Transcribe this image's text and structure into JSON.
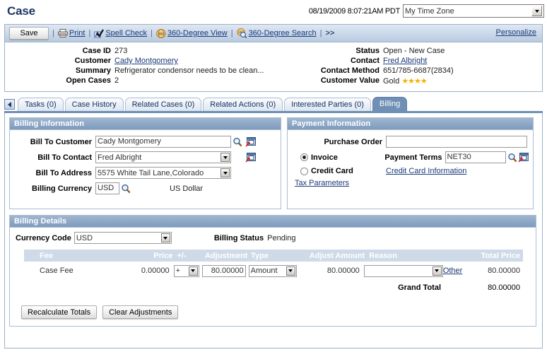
{
  "header": {
    "title": "Case",
    "datetime": "08/19/2009 8:07:21AM PDT",
    "timezone_value": "My Time Zone"
  },
  "toolbar": {
    "save_label": "Save",
    "print_label": "Print",
    "spell_check_label": "Spell Check",
    "view_360_label": "360-Degree View",
    "search_360_label": "360-Degree Search",
    "more_label": ">>",
    "personalize_label": "Personalize",
    "separator": "|"
  },
  "summary": {
    "left": [
      {
        "label": "Case ID",
        "value": "273",
        "link": false
      },
      {
        "label": "Customer",
        "value": "Cady Montgomery",
        "link": true
      },
      {
        "label": "Summary",
        "value": "Refrigerator condensor needs to be clean...",
        "link": false
      },
      {
        "label": "Open Cases",
        "value": "2",
        "link": false
      }
    ],
    "right": [
      {
        "label": "Status",
        "value": "Open - New Case",
        "link": false
      },
      {
        "label": "Contact",
        "value": "Fred Albright",
        "link": true
      },
      {
        "label": "Contact Method",
        "value": "651/785-6687(2834)",
        "link": false
      },
      {
        "label": "Customer Value",
        "value": "Gold",
        "link": false,
        "stars": "★★★★"
      }
    ]
  },
  "tabs": [
    {
      "label": "Tasks (0)",
      "active": false
    },
    {
      "label": "Case History",
      "active": false
    },
    {
      "label": "Related Cases (0)",
      "active": false
    },
    {
      "label": "Related Actions (0)",
      "active": false
    },
    {
      "label": "Interested Parties (0)",
      "active": false
    },
    {
      "label": "Billing",
      "active": true
    }
  ],
  "billing_information": {
    "title": "Billing Information",
    "bill_to_customer_label": "Bill To Customer",
    "bill_to_customer_value": "Cady Montgomery",
    "bill_to_contact_label": "Bill To Contact",
    "bill_to_contact_value": "Fred Albright",
    "bill_to_address_label": "Bill To Address",
    "bill_to_address_value": "5575 White Tail Lane,Colorado",
    "billing_currency_label": "Billing Currency",
    "billing_currency_value": "USD",
    "billing_currency_desc": "US Dollar"
  },
  "payment_information": {
    "title": "Payment Information",
    "purchase_order_label": "Purchase Order",
    "purchase_order_value": "",
    "purchase_order_placeholder": "",
    "invoice_label": "Invoice",
    "invoice_selected": true,
    "credit_card_label": "Credit Card",
    "credit_card_selected": false,
    "payment_terms_label": "Payment Terms",
    "payment_terms_value": "NET30",
    "credit_card_info_link": "Credit Card Information",
    "tax_parameters_link": "Tax Parameters"
  },
  "billing_details": {
    "title": "Billing Details",
    "currency_code_label": "Currency Code",
    "currency_code_value": "USD",
    "billing_status_label": "Billing Status",
    "billing_status_value": "Pending",
    "columns": [
      "Fee",
      "Price",
      "+/-",
      "Adjustment",
      "Type",
      "Adjust Amount",
      "Reason",
      "Total Price"
    ],
    "rows": [
      {
        "fee": "Case Fee",
        "price": "0.00000",
        "plus_minus": "+",
        "adjustment": "80.00000",
        "type": "Amount",
        "adjust_amount": "80.00000",
        "reason": "",
        "other_link": "Other",
        "total_price": "80.00000"
      }
    ],
    "grand_total_label": "Grand Total",
    "grand_total_value": "80.00000",
    "recalculate_label": "Recalculate Totals",
    "clear_adjustments_label": "Clear Adjustments"
  },
  "colors": {
    "title_blue": "#1f3864",
    "link_blue": "#1a3a7a",
    "panel_header": "#7e9bbd",
    "active_tab": "#6f8fb5",
    "grid_header": "#cfdae8",
    "star_gold": "#f0b400"
  }
}
